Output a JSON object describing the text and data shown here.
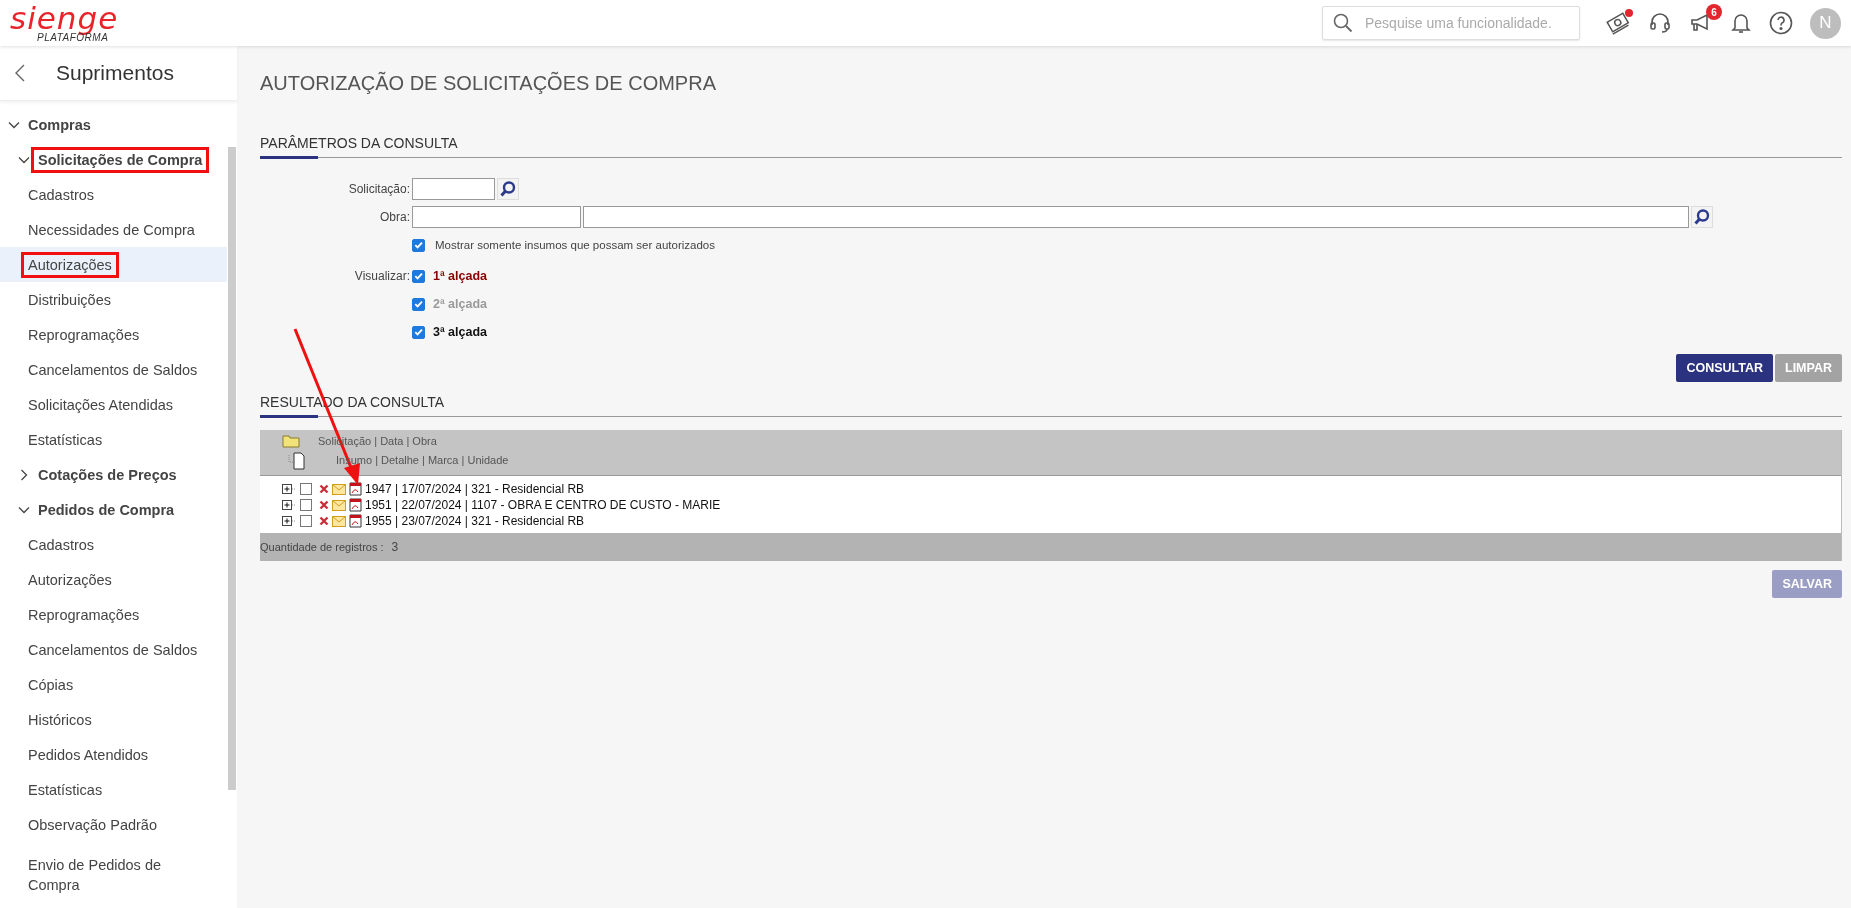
{
  "header": {
    "logo": "sienge",
    "logo_subtitle": "PLATAFORMA",
    "search": {
      "placeholder": "Pesquise uma funcionalidade."
    },
    "announcements_badge": "6",
    "avatar": "N"
  },
  "sidebar": {
    "title": "Suprimentos",
    "items": [
      {
        "label": "Compras",
        "expanded": true,
        "annotated": false,
        "children": [
          {
            "label": "Solicitações de Compra",
            "expanded": true,
            "annotated": true,
            "children": [
              {
                "label": "Cadastros",
                "selected": false,
                "annotated": false
              },
              {
                "label": "Necessidades de Compra",
                "selected": false,
                "annotated": false
              },
              {
                "label": "Autorizações",
                "selected": true,
                "annotated": true
              },
              {
                "label": "Distribuições",
                "selected": false,
                "annotated": false
              },
              {
                "label": "Reprogramações",
                "selected": false,
                "annotated": false
              },
              {
                "label": "Cancelamentos de Saldos",
                "selected": false,
                "annotated": false
              },
              {
                "label": "Solicitações Atendidas",
                "selected": false,
                "annotated": false
              },
              {
                "label": "Estatísticas",
                "selected": false,
                "annotated": false
              }
            ]
          },
          {
            "label": "Cotações de Preços",
            "expanded": false,
            "annotated": false
          },
          {
            "label": "Pedidos de Compra",
            "expanded": true,
            "annotated": false,
            "children": [
              {
                "label": "Cadastros",
                "selected": false,
                "annotated": false
              },
              {
                "label": "Autorizações",
                "selected": false,
                "annotated": false
              },
              {
                "label": "Reprogramações",
                "selected": false,
                "annotated": false
              },
              {
                "label": "Cancelamentos de Saldos",
                "selected": false,
                "annotated": false
              },
              {
                "label": "Cópias",
                "selected": false,
                "annotated": false
              },
              {
                "label": "Históricos",
                "selected": false,
                "annotated": false
              },
              {
                "label": "Pedidos Atendidos",
                "selected": false,
                "annotated": false
              },
              {
                "label": "Estatísticas",
                "selected": false,
                "annotated": false
              },
              {
                "label": "Observação Padrão",
                "selected": false,
                "annotated": false
              },
              {
                "label": "Envio de Pedidos de Compra",
                "selected": false,
                "annotated": false
              }
            ]
          }
        ]
      }
    ]
  },
  "page_title": "AUTORIZAÇÃO DE SOLICITAÇÕES DE COMPRA",
  "parameters": {
    "heading": "PARÂMETROS DA CONSULTA",
    "solicitacao_label": "Solicitação:",
    "obra_label": "Obra:",
    "only_authorizable": {
      "label": "Mostrar somente insumos que possam ser autorizados",
      "checked": true
    },
    "visualizar_label": "Visualizar:",
    "levels": [
      {
        "label": "1ª alçada",
        "checked": true,
        "color": "#8b0000"
      },
      {
        "label": "2ª alçada",
        "checked": true,
        "color": "#9a9a9a"
      },
      {
        "label": "3ª alçada",
        "checked": true,
        "color": "#111111"
      }
    ],
    "buttons": [
      {
        "label": "CONSULTAR",
        "kind": "primary"
      },
      {
        "label": "LIMPAR",
        "kind": "secondary"
      }
    ]
  },
  "results": {
    "heading": "RESULTADO DA CONSULTA",
    "header_line_1": "Solicitação | Data | Obra",
    "header_line_2": "Insumo | Detalhe | Marca | Unidade",
    "rows": [
      {
        "text": "1947 | 17/07/2024 | 321 - Residencial RB",
        "checked": false
      },
      {
        "text": "1951 | 22/07/2024 | 1107 - OBRA E CENTRO DE CUSTO - MARIE",
        "checked": false
      },
      {
        "text": "1955 | 23/07/2024 | 321 - Residencial RB",
        "checked": false
      }
    ],
    "count_label": "Quantidade de registros :",
    "count": "3"
  },
  "save_button": {
    "label": "SALVAR",
    "disabled": true
  }
}
